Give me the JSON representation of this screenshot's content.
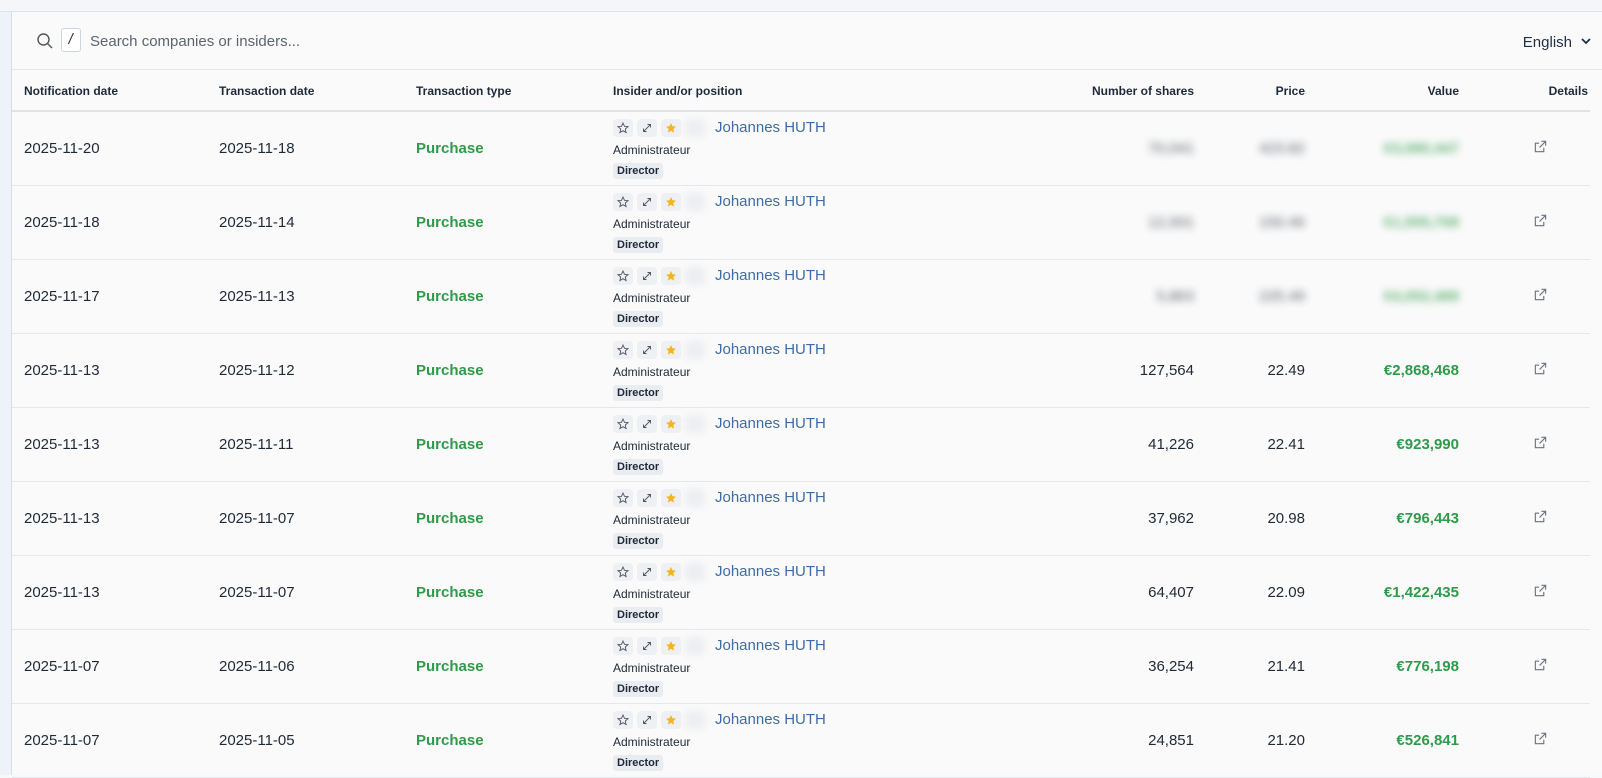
{
  "search": {
    "slash_key": "/",
    "placeholder": "Search companies or insiders..."
  },
  "language": {
    "label": "English"
  },
  "table": {
    "headers": {
      "notification_date": "Notification date",
      "transaction_date": "Transaction date",
      "transaction_type": "Transaction type",
      "insider": "Insider and/or position",
      "shares": "Number of shares",
      "price": "Price",
      "value": "Value",
      "details": "Details"
    },
    "rows": [
      {
        "notification_date": "2025-11-20",
        "transaction_date": "2025-11-18",
        "type": "Purchase",
        "insider_name": "Johannes HUTH",
        "role": "Administrateur",
        "position": "Director",
        "shares": "70,041",
        "price": "423.82",
        "value": "€3,080,447",
        "obscured": true
      },
      {
        "notification_date": "2025-11-18",
        "transaction_date": "2025-11-14",
        "type": "Purchase",
        "insider_name": "Johannes HUTH",
        "role": "Administrateur",
        "position": "Director",
        "shares": "12,001",
        "price": "150.46",
        "value": "€1,555,708",
        "obscured": true
      },
      {
        "notification_date": "2025-11-17",
        "transaction_date": "2025-11-13",
        "type": "Purchase",
        "insider_name": "Johannes HUTH",
        "role": "Administrateur",
        "position": "Director",
        "shares": "5,863",
        "price": "225.49",
        "value": "€4,052,489",
        "obscured": true
      },
      {
        "notification_date": "2025-11-13",
        "transaction_date": "2025-11-12",
        "type": "Purchase",
        "insider_name": "Johannes HUTH",
        "role": "Administrateur",
        "position": "Director",
        "shares": "127,564",
        "price": "22.49",
        "value": "€2,868,468",
        "obscured": false
      },
      {
        "notification_date": "2025-11-13",
        "transaction_date": "2025-11-11",
        "type": "Purchase",
        "insider_name": "Johannes HUTH",
        "role": "Administrateur",
        "position": "Director",
        "shares": "41,226",
        "price": "22.41",
        "value": "€923,990",
        "obscured": false
      },
      {
        "notification_date": "2025-11-13",
        "transaction_date": "2025-11-07",
        "type": "Purchase",
        "insider_name": "Johannes HUTH",
        "role": "Administrateur",
        "position": "Director",
        "shares": "37,962",
        "price": "20.98",
        "value": "€796,443",
        "obscured": false
      },
      {
        "notification_date": "2025-11-13",
        "transaction_date": "2025-11-07",
        "type": "Purchase",
        "insider_name": "Johannes HUTH",
        "role": "Administrateur",
        "position": "Director",
        "shares": "64,407",
        "price": "22.09",
        "value": "€1,422,435",
        "obscured": false
      },
      {
        "notification_date": "2025-11-07",
        "transaction_date": "2025-11-06",
        "type": "Purchase",
        "insider_name": "Johannes HUTH",
        "role": "Administrateur",
        "position": "Director",
        "shares": "36,254",
        "price": "21.41",
        "value": "€776,198",
        "obscured": false
      },
      {
        "notification_date": "2025-11-07",
        "transaction_date": "2025-11-05",
        "type": "Purchase",
        "insider_name": "Johannes HUTH",
        "role": "Administrateur",
        "position": "Director",
        "shares": "24,851",
        "price": "21.20",
        "value": "€526,841",
        "obscured": false
      }
    ]
  },
  "colors": {
    "purchase_green": "#2f9b4a",
    "insider_link": "#3e6ca6",
    "star_gold": "#f2b51d"
  },
  "icons": {
    "search": "search-icon",
    "dropdown": "chevron-down-icon",
    "watch": "star-outline-icon",
    "expand": "expand-icon",
    "favorite": "star-filled-icon",
    "details": "external-link-icon"
  }
}
